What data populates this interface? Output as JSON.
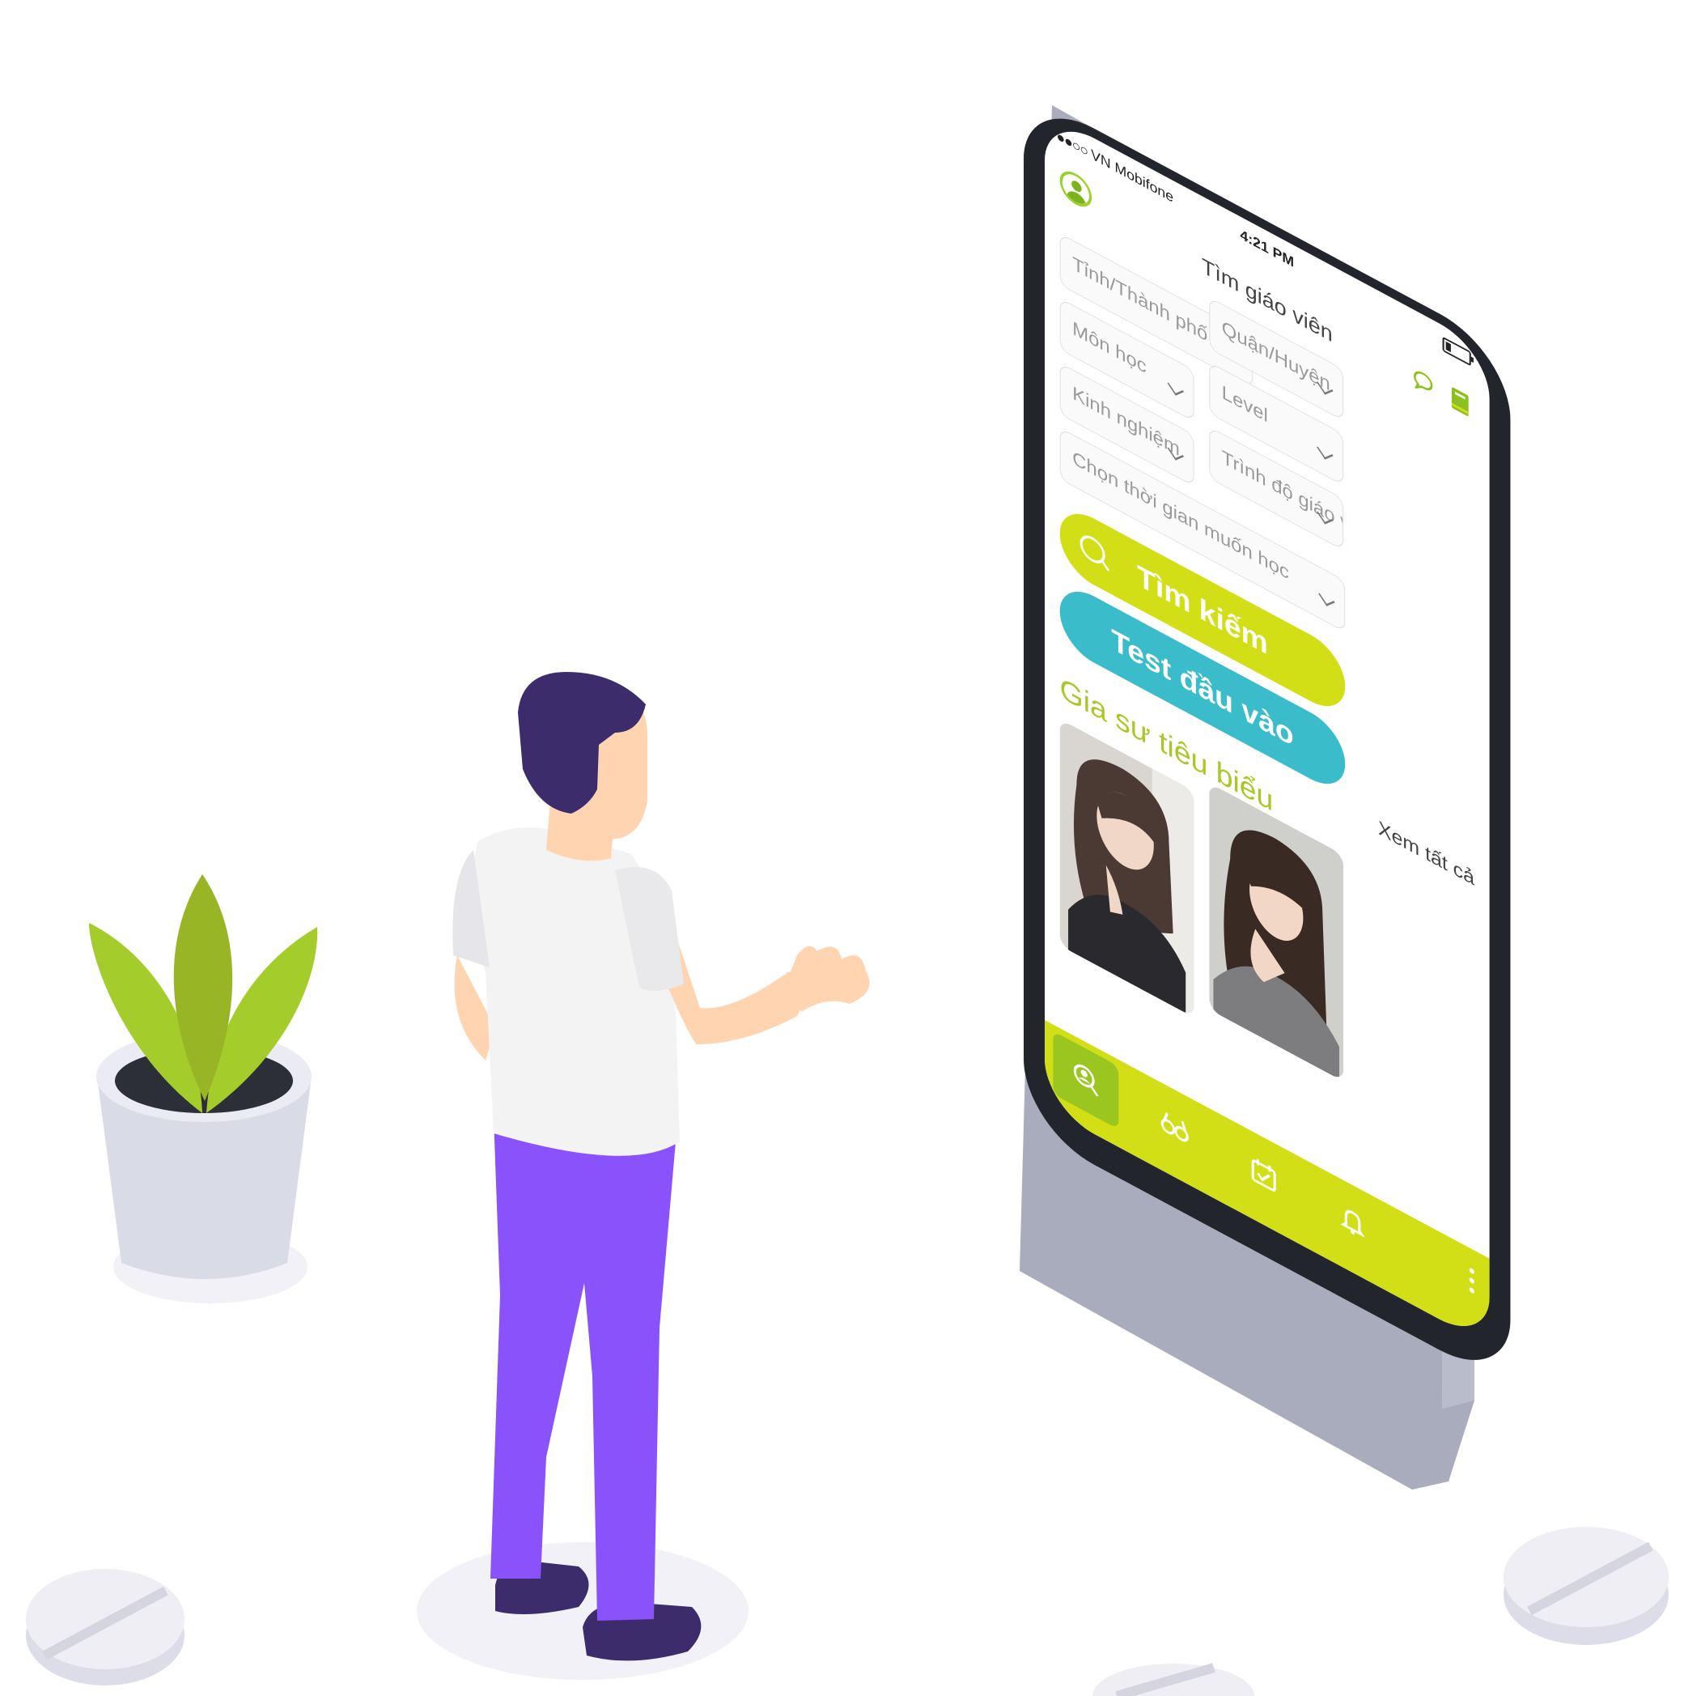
{
  "status_bar": {
    "signal": "●●○○",
    "carrier": "VN Mobifone",
    "time": "4:21 PM"
  },
  "header": {
    "title": "Tìm giáo viên"
  },
  "filters": {
    "province": "Tỉnh/Thành phố",
    "district": "Quận/Huyện",
    "subject": "Môn học",
    "level": "Level",
    "experience": "Kinh nghiệm",
    "teacher_qualification": "Trình độ giáo viên",
    "schedule": "Chọn thời gian muốn học"
  },
  "buttons": {
    "search": "Tìm kiếm",
    "entry_test": "Test đầu vào"
  },
  "featured": {
    "title": "Gia sư tiêu biểu",
    "see_all": "Xem tất cả"
  },
  "tabbar": {
    "tabs": [
      {
        "icon": "user-search-icon",
        "active": true
      },
      {
        "icon": "glasses-icon",
        "active": false
      },
      {
        "icon": "calendar-check-icon",
        "active": false
      },
      {
        "icon": "bell-icon",
        "active": false
      },
      {
        "icon": "more-vertical-icon",
        "active": false
      }
    ]
  },
  "colors": {
    "brand_green": "#d3df16",
    "accent_green": "#a6c925",
    "accent_teal": "#3bbccb",
    "phone_frame": "#22252b",
    "phone_side": "#a9acbd",
    "pants": "#8a52fb",
    "hair": "#3d2c6c",
    "plant_leaf": "#a4cd2c",
    "skin": "#ffd4b1"
  }
}
